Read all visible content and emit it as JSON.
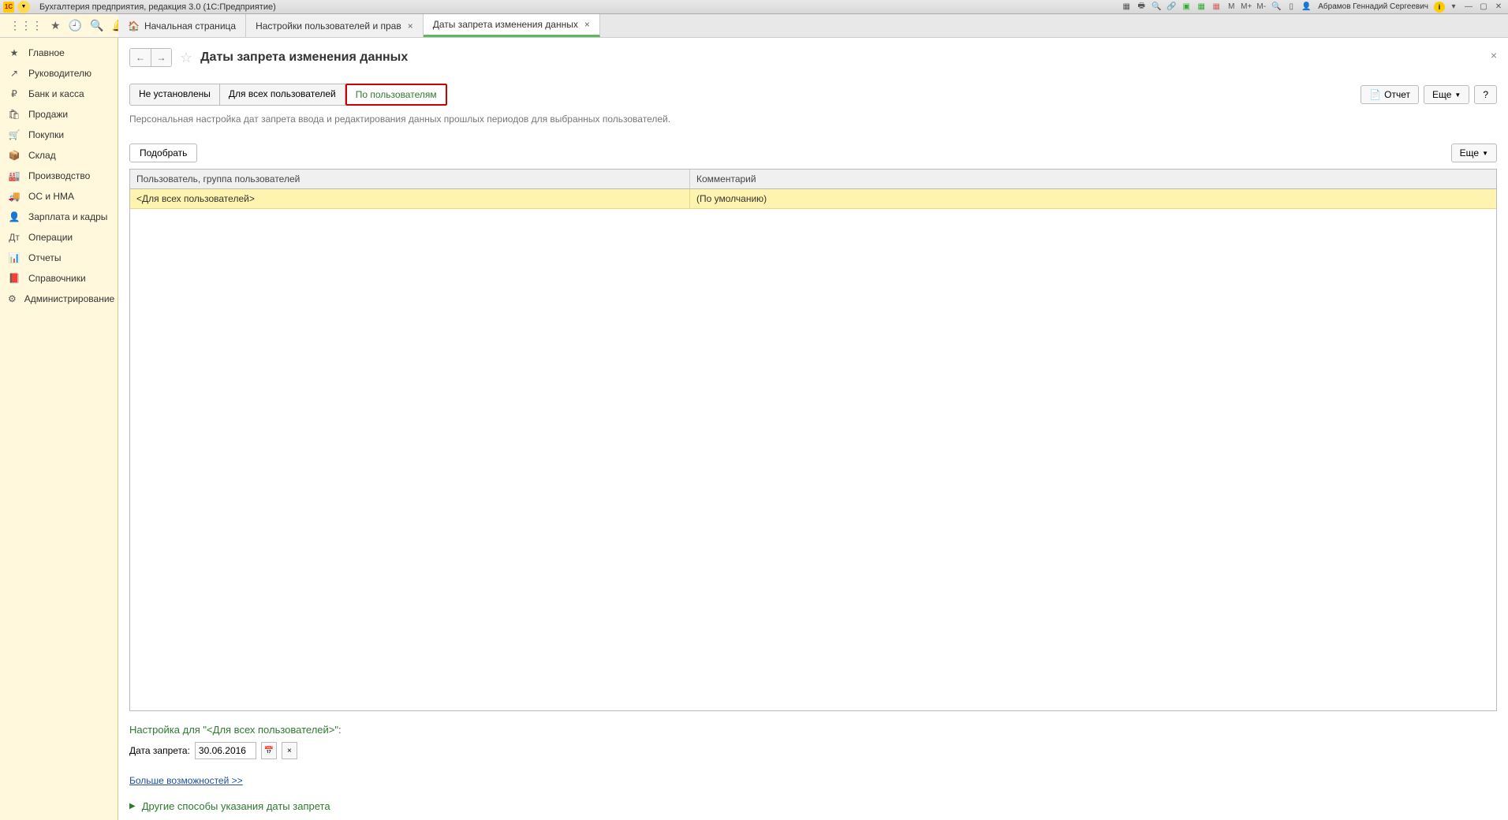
{
  "titlebar": {
    "logo_text": "1C",
    "app_title": "Бухгалтерия предприятия, редакция 3.0  (1С:Предприятие)",
    "user_name": "Абрамов Геннадий Сергеевич",
    "mem_labels": [
      "M",
      "M+",
      "M-"
    ]
  },
  "tabs": [
    {
      "label": "Начальная страница",
      "has_home": true,
      "closable": false,
      "active": false
    },
    {
      "label": "Настройки пользователей и прав",
      "has_home": false,
      "closable": true,
      "active": false
    },
    {
      "label": "Даты запрета изменения данных",
      "has_home": false,
      "closable": true,
      "active": true
    }
  ],
  "sidebar": {
    "items": [
      {
        "icon": "★",
        "label": "Главное"
      },
      {
        "icon": "↗",
        "label": "Руководителю"
      },
      {
        "icon": "₽",
        "label": "Банк и касса"
      },
      {
        "icon": "🛍",
        "label": "Продажи"
      },
      {
        "icon": "🛒",
        "label": "Покупки"
      },
      {
        "icon": "📦",
        "label": "Склад"
      },
      {
        "icon": "🏭",
        "label": "Производство"
      },
      {
        "icon": "🚚",
        "label": "ОС и НМА"
      },
      {
        "icon": "👤",
        "label": "Зарплата и кадры"
      },
      {
        "icon": "Дт",
        "label": "Операции"
      },
      {
        "icon": "📊",
        "label": "Отчеты"
      },
      {
        "icon": "📕",
        "label": "Справочники"
      },
      {
        "icon": "⚙",
        "label": "Администрирование"
      }
    ]
  },
  "page": {
    "title": "Даты запрета изменения данных",
    "filter_tabs": [
      {
        "label": "Не установлены",
        "highlighted": false
      },
      {
        "label": "Для всех пользователей",
        "highlighted": false
      },
      {
        "label": "По пользователям",
        "highlighted": true
      }
    ],
    "report_btn": "Отчет",
    "more_btn": "Еще",
    "help_btn": "?",
    "description": "Персональная настройка дат запрета ввода и редактирования данных прошлых периодов для выбранных пользователей.",
    "select_btn": "Подобрать",
    "table": {
      "columns": [
        "Пользователь, группа пользователей",
        "Комментарий"
      ],
      "rows": [
        {
          "user": "<Для всех пользователей>",
          "comment": "(По умолчанию)"
        }
      ]
    },
    "settings_title": "Настройка для \"<Для всех пользователей>\":",
    "date_label": "Дата запрета:",
    "date_value": "30.06.2016",
    "more_link": "Больше возможностей >>",
    "expand_link": "Другие способы указания даты запрета"
  }
}
